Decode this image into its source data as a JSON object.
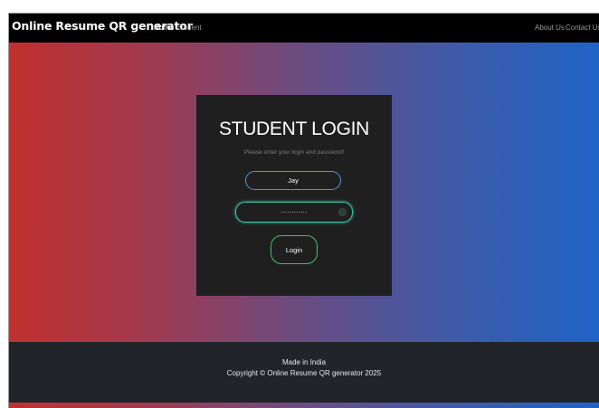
{
  "navbar": {
    "brand": "Online Resume QR generator",
    "links_left": [
      "Home",
      "Student"
    ],
    "links_right": [
      "About Us",
      "Contact Us"
    ]
  },
  "login": {
    "title": "STUDENT LOGIN",
    "subtitle": "Please enter your login and password!",
    "username_value": "Jay",
    "password_mask": "............",
    "button_label": "Login"
  },
  "footer": {
    "line1": "Made in India",
    "line2": "Copyright © Online Resume QR generator 2025"
  },
  "colors": {
    "navbar_bg": "#000000",
    "gradient_left": "#c0302e",
    "gradient_right": "#1f63c6",
    "card_bg": "#1f1f1f",
    "username_border": "#5a8fd6",
    "password_border": "#3fc3a6",
    "button_border": "#3fc36a",
    "footer_bg": "#212529"
  }
}
